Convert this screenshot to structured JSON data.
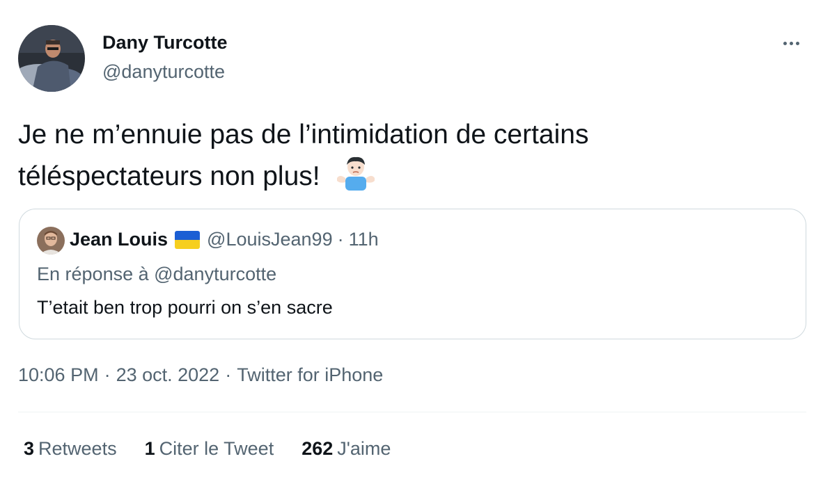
{
  "author": {
    "name": "Dany Turcotte",
    "handle": "@danyturcotte"
  },
  "tweet": {
    "line1": "Je ne m’ennuie pas de l’intimidation de certains",
    "line2": "téléspectateurs non plus!",
    "emoji": "person-shrugging-icon"
  },
  "quote": {
    "name": "Jean Louis",
    "flag": "ukraine-flag-icon",
    "handle": "@LouisJean99",
    "separator": "·",
    "time": "11h",
    "reply_to": "En réponse à @danyturcotte",
    "text": "T’etait ben trop pourri on s’en sacre"
  },
  "meta": {
    "time": "10:06 PM",
    "separator": "·",
    "date": "23 oct. 2022",
    "source": "Twitter for iPhone"
  },
  "stats": [
    {
      "count": "3",
      "label": "Retweets"
    },
    {
      "count": "1",
      "label": "Citer le Tweet"
    },
    {
      "count": "262",
      "label": "J'aime"
    }
  ],
  "colors": {
    "primary_text": "#0f1419",
    "secondary_text": "#536471",
    "border": "#cfd9de",
    "divider": "#eff3f4"
  }
}
